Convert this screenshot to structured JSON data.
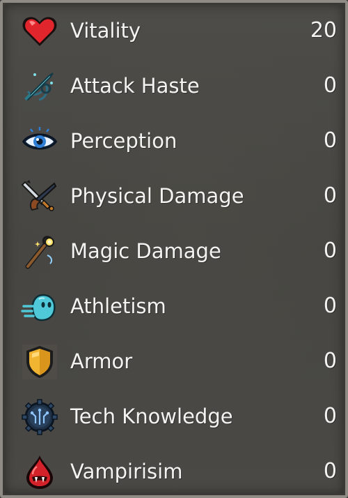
{
  "stats": [
    {
      "label": "Vitality",
      "value": "20",
      "icon": "heart-icon"
    },
    {
      "label": "Attack Haste",
      "value": "0",
      "icon": "sword-swirl-icon"
    },
    {
      "label": "Perception",
      "value": "0",
      "icon": "eye-icon"
    },
    {
      "label": "Physical Damage",
      "value": "0",
      "icon": "sword-pistol-icon"
    },
    {
      "label": "Magic Damage",
      "value": "0",
      "icon": "magic-wand-icon"
    },
    {
      "label": "Athletism",
      "value": "0",
      "icon": "ghost-dash-icon"
    },
    {
      "label": "Armor",
      "value": "0",
      "icon": "shield-icon"
    },
    {
      "label": "Tech Knowledge",
      "value": "0",
      "icon": "gear-circuit-icon"
    },
    {
      "label": "Vampirisim",
      "value": "0",
      "icon": "blood-drop-fangs-icon"
    }
  ]
}
